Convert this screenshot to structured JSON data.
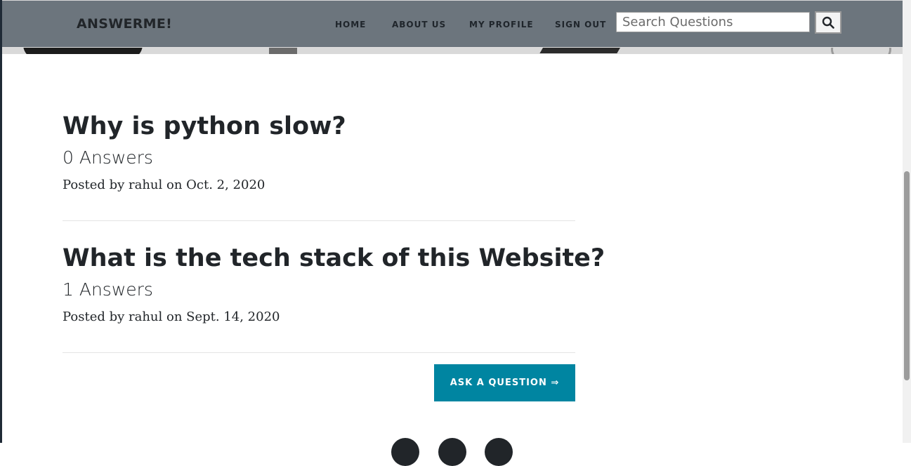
{
  "navbar": {
    "brand": "ANSWERME!",
    "links": [
      "HOME",
      "ABOUT US",
      "MY PROFILE",
      "SIGN OUT"
    ],
    "search_placeholder": "Search Questions",
    "search_icon": "search-icon"
  },
  "questions": [
    {
      "title": "Why is python slow?",
      "answers": "0 Answers",
      "meta": "Posted by rahul on Oct. 2, 2020"
    },
    {
      "title": "What is the tech stack of this Website?",
      "answers": "1 Answers",
      "meta": "Posted by rahul on Sept. 14, 2020"
    }
  ],
  "ask_button": "ASK A QUESTION ⇒",
  "colors": {
    "navbar_bg": "#6c757d",
    "button_bg": "#0085a1",
    "text": "#212529"
  }
}
